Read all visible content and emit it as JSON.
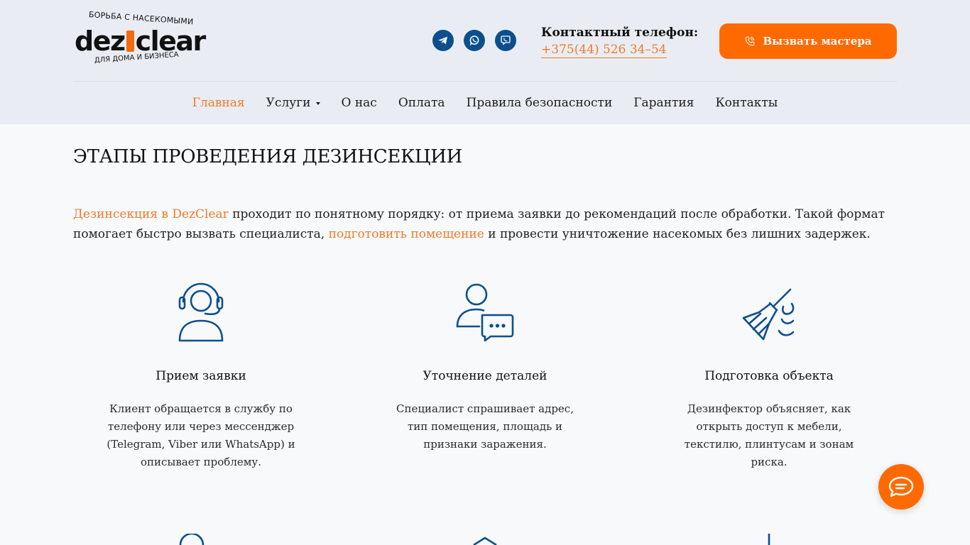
{
  "logo": {
    "top_text": "БОРЬБА С НАСЕКОМЫМИ",
    "brand_left": "dez",
    "brand_right": "clear",
    "bottom_text": "ДЛЯ ДОМА И БИЗНЕСА"
  },
  "social": [
    {
      "name": "telegram",
      "icon": "telegram-icon"
    },
    {
      "name": "whatsapp",
      "icon": "whatsapp-icon"
    },
    {
      "name": "viber",
      "icon": "viber-icon"
    }
  ],
  "contact": {
    "label": "Контактный телефон:",
    "phone": "+375(44) 526 34–54"
  },
  "call_button": {
    "label": "Вызвать мастера",
    "icon": "phone-icon"
  },
  "nav": {
    "items": [
      {
        "label": "Главная",
        "active": true
      },
      {
        "label": "Услуги",
        "dropdown": true
      },
      {
        "label": "О нас"
      },
      {
        "label": "Оплата"
      },
      {
        "label": "Правила безопасности"
      },
      {
        "label": "Гарантия"
      },
      {
        "label": "Контакты"
      }
    ]
  },
  "main": {
    "title": "ЭТАПЫ ПРОВЕДЕНИЯ ДЕЗИНСЕКЦИИ",
    "intro": {
      "link1": "Дезинсекция в DezClear",
      "text1": " проходит по понятному порядку: от приема заявки до рекомендаций после обработки. Такой формат помогает быстро вызвать специалиста, ",
      "link2": "подготовить помещение",
      "text2": " и провести уничтожение насекомых без лишних задержек."
    },
    "steps": [
      {
        "icon": "operator-headset-icon",
        "title": "Прием заявки",
        "description": "Клиент обращается в службу по телефону или через мессенджер (Telegram, Viber или WhatsApp) и описывает проблему."
      },
      {
        "icon": "person-chat-icon",
        "title": "Уточнение деталей",
        "description": "Специалист спрашивает адрес, тип помещения, площадь и признаки заражения."
      },
      {
        "icon": "broom-icon",
        "title": "Подготовка объекта",
        "description": "Дезинфектор объясняет, как открыть доступ к мебели, текстилю, плинтусам и зонам риска."
      }
    ]
  },
  "chat_widget": {
    "icon": "chat-bubble-icon"
  },
  "colors": {
    "accent": "#ff6a00",
    "link": "#f07a2a",
    "icon_blue": "#0d4f8c",
    "header_bg": "#e9edf3",
    "page_bg": "#f7f9fb"
  }
}
